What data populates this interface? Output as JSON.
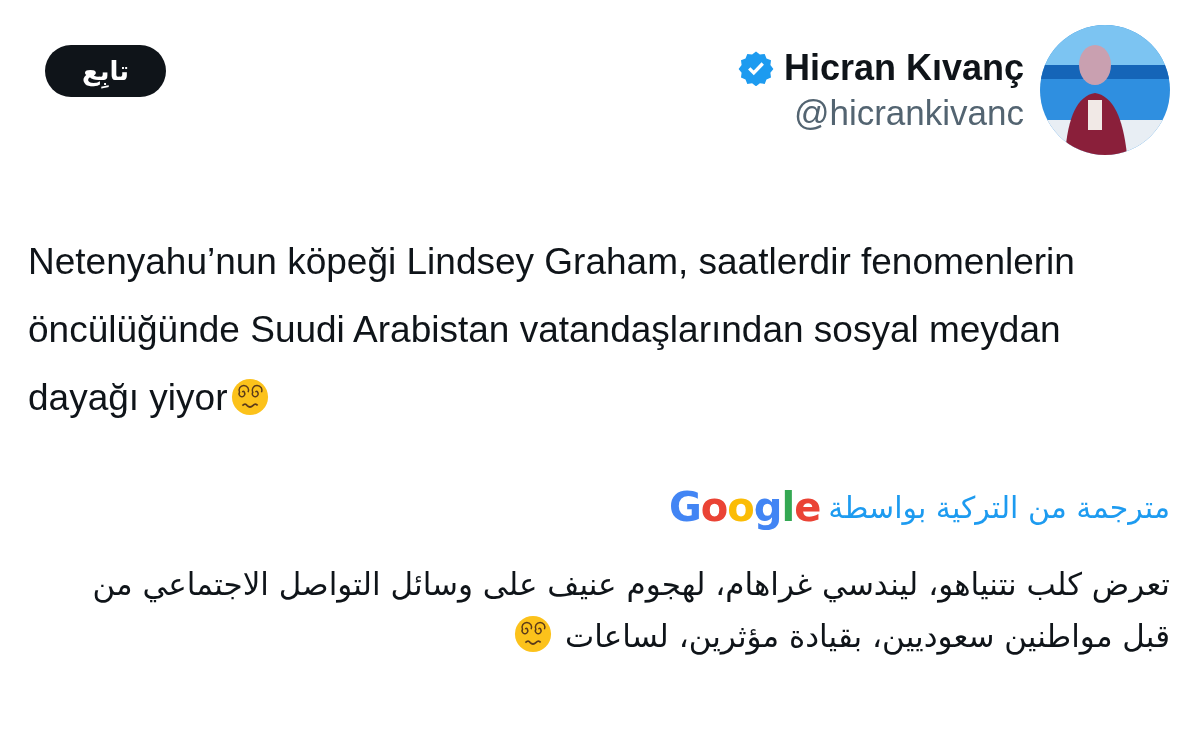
{
  "author": {
    "name": "Hicran Kıvanç",
    "handle": "@hicrankivanc",
    "verified": true
  },
  "follow_button": {
    "label": "تابِع"
  },
  "tweet_text": "Netenyahu’nun köpeği Lindsey Graham, saatlerdir fenomenlerin öncülüğünde Suudi Arabistan vatandaşlarından sosyal meydan dayağı yiyor",
  "translation": {
    "label": "مترجمة من التركية بواسطة",
    "provider": "Google",
    "text": "تعرض كلب نتنياهو، ليندسي غراهام، لهجوم عنيف على وسائل التواصل الاجتماعي من قبل مواطنين سعوديين، بقيادة مؤثرين، لساعات"
  }
}
